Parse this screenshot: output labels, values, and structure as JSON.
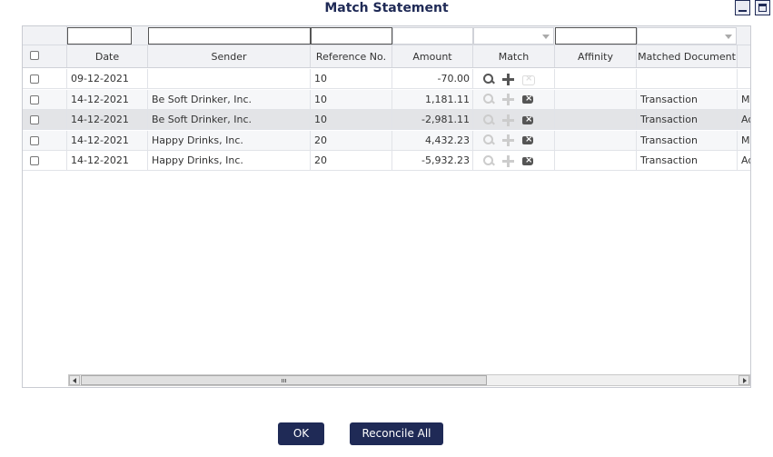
{
  "dialog": {
    "title": "Match Statement"
  },
  "columns": [
    "Date",
    "Sender",
    "Reference No.",
    "Amount",
    "Match",
    "Affinity",
    "Matched Document",
    ""
  ],
  "rows": [
    {
      "date": "09-12-2021",
      "sender": "",
      "ref": "10",
      "amount": "-70.00",
      "doc": "",
      "extra": "",
      "state": "normal",
      "search": "on",
      "plus": "on",
      "del": "off"
    },
    {
      "date": "14-12-2021",
      "sender": "Be Soft Drinker, Inc.",
      "ref": "10",
      "amount": "1,181.11",
      "doc": "Transaction",
      "extra": "M",
      "state": "alt",
      "search": "off",
      "plus": "off",
      "del": "on"
    },
    {
      "date": "14-12-2021",
      "sender": "Be Soft Drinker, Inc.",
      "ref": "10",
      "amount": "-2,981.11",
      "doc": "Transaction",
      "extra": "Ad",
      "state": "sel",
      "search": "off",
      "plus": "off",
      "del": "on"
    },
    {
      "date": "14-12-2021",
      "sender": "Happy Drinks, Inc.",
      "ref": "20",
      "amount": "4,432.23",
      "doc": "Transaction",
      "extra": "M",
      "state": "alt",
      "search": "off",
      "plus": "off",
      "del": "on"
    },
    {
      "date": "14-12-2021",
      "sender": "Happy Drinks, Inc.",
      "ref": "20",
      "amount": "-5,932.23",
      "doc": "Transaction",
      "extra": "Ad",
      "state": "normal",
      "search": "off",
      "plus": "off",
      "del": "on"
    }
  ],
  "buttons": {
    "ok": "OK",
    "reconcile_all": "Reconcile All"
  },
  "colors": {
    "accent": "#1f2a56"
  }
}
